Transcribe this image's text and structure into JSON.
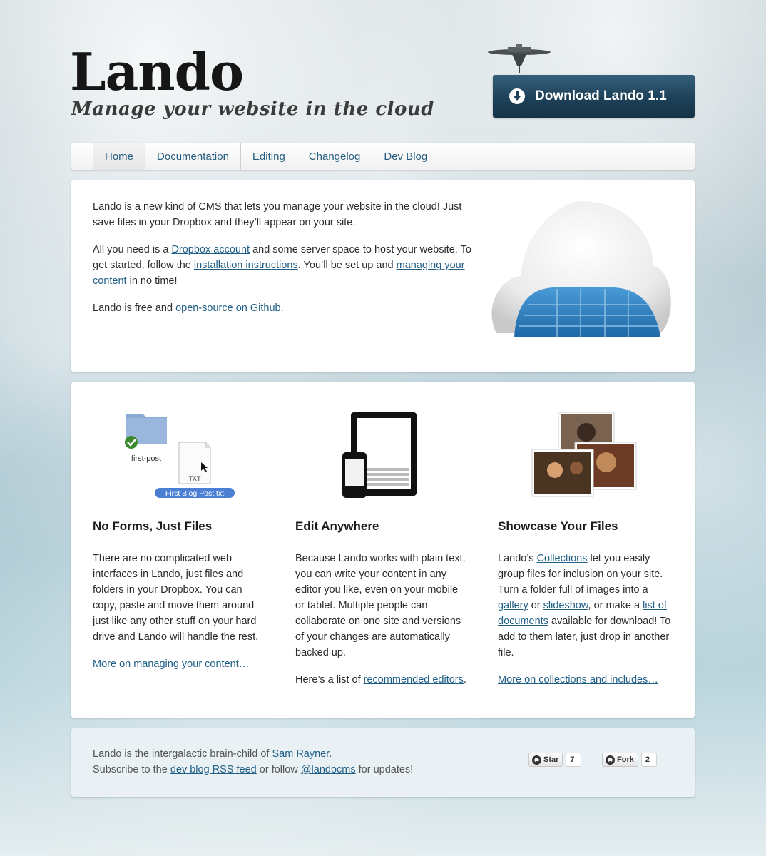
{
  "header": {
    "logo_title": "Lando",
    "tagline": "Manage your website in the cloud",
    "download_label": "Download Lando 1.1"
  },
  "nav": {
    "items": [
      {
        "label": "Home",
        "active": true
      },
      {
        "label": "Documentation",
        "active": false
      },
      {
        "label": "Editing",
        "active": false
      },
      {
        "label": "Changelog",
        "active": false
      },
      {
        "label": "Dev Blog",
        "active": false
      }
    ]
  },
  "intro": {
    "p1": "Lando is a new kind of CMS that lets you manage your website in the cloud! Just save files in your Dropbox and they’ll appear on your site.",
    "p2_a": "All you need is a ",
    "p2_link1": "Dropbox account",
    "p2_b": " and some server space to host your website. To get started, follow the ",
    "p2_link2": "installation instructions",
    "p2_c": ". You’ll be set up and ",
    "p2_link3": "managing your content",
    "p2_d": " in no time!",
    "p3_a": "Lando is free and ",
    "p3_link": "open-source on Github",
    "p3_b": "."
  },
  "features": {
    "files": {
      "title": "No Forms, Just Files",
      "body": "There are no complicated web interfaces in Lando, just files and folders in your Dropbox. You can copy, paste and move them around just like any other stuff on your hard drive and Lando will handle the rest.",
      "link": "More on managing your content…",
      "folder_label": "first-post",
      "file_type": "TXT",
      "file_name": "First Blog Post.txt"
    },
    "edit": {
      "title": "Edit Anywhere",
      "body": "Because Lando works with plain text, you can write your content in any editor you like, even on your mobile or tablet. Multiple people can collaborate on one site and versions of your changes are automatically backed up.",
      "p2_a": "Here’s a list of ",
      "p2_link": "recommended editors",
      "p2_b": "."
    },
    "showcase": {
      "title": "Showcase Your Files",
      "a": "Lando’s ",
      "link1": "Collections",
      "b": " let you easily group files for inclusion on your site. Turn a folder full of images into a ",
      "link2": "gallery",
      "c": " or ",
      "link3": "slideshow",
      "d": ", or make a ",
      "link4": "list of documents",
      "e": " available for download! To add to them later, just drop in another file.",
      "more_link": "More on collections and includes…"
    }
  },
  "footer": {
    "a": "Lando is the intergalactic brain-child of ",
    "author": "Sam Rayner",
    "b": ".",
    "c": "Subscribe to the ",
    "rss": "dev blog RSS feed",
    "d": " or follow ",
    "twitter": "@landocms",
    "e": " for updates!",
    "star_label": "Star",
    "star_count": "7",
    "fork_label": "Fork",
    "fork_count": "2"
  },
  "colors": {
    "link": "#1f5f86",
    "download_button": "#1d4158",
    "cloud_blue": "#2f7fc0"
  }
}
